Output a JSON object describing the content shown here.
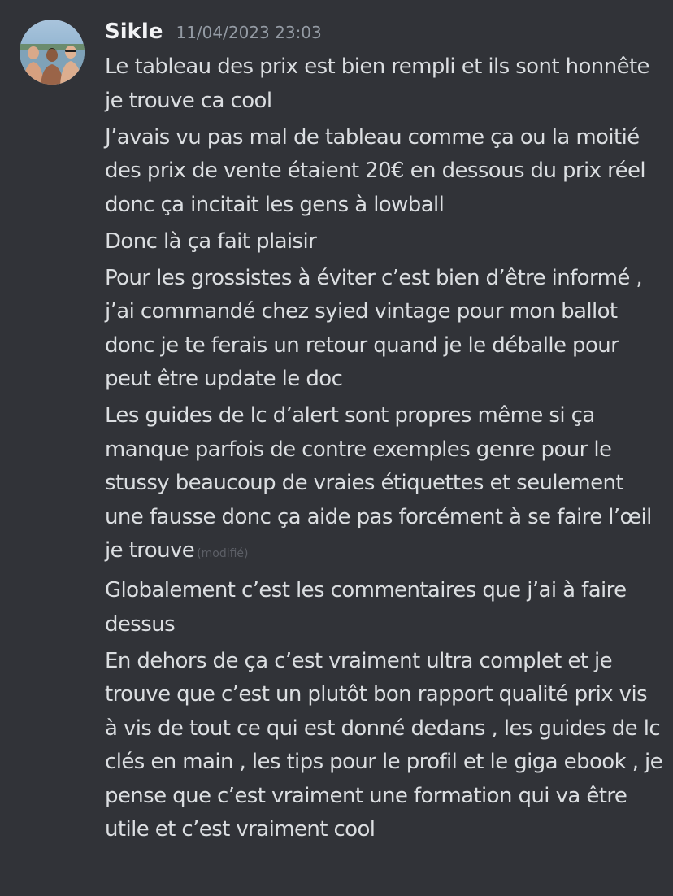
{
  "author": {
    "name": "Sikle",
    "timestamp": "11/04/2023 23:03"
  },
  "messages": [
    {
      "text": "Le tableau des prix est bien rempli et ils sont honnête je trouve ca cool"
    },
    {
      "text": "J’avais vu pas mal de tableau comme ça ou la moitié des prix de vente étaient 20€ en dessous du prix réel donc ça incitait les gens à lowball"
    },
    {
      "text": "Donc là ça fait plaisir"
    },
    {
      "text": "Pour les grossistes à éviter c’est bien d’être informé , j’ai commandé chez syied vintage pour mon ballot donc je te ferais un retour quand je le déballe pour peut être update le doc"
    },
    {
      "text": "Les guides de lc d’alert sont propres même si ça manque parfois de contre exemples genre pour le stussy beaucoup de vraies étiquettes et seulement une fausse donc ça aide pas forcément à se faire l’œil je trouve",
      "edited": "(modifié)"
    },
    {
      "text": "Globalement c’est les commentaires que j’ai à faire dessus"
    },
    {
      "text": "En dehors de ça c’est vraiment ultra complet et je trouve que c’est un plutôt bon rapport qualité prix vis à vis de tout ce qui est donné dedans , les guides de lc clés en main , les tips pour le profil et le giga ebook , je pense que c’est vraiment une formation qui va être utile et c’est vraiment cool"
    }
  ],
  "colors": {
    "background": "#313338",
    "text": "#dbdee1",
    "username": "#f2f3f5",
    "timestamp": "#949ba4",
    "edited": "#5c5f66"
  }
}
